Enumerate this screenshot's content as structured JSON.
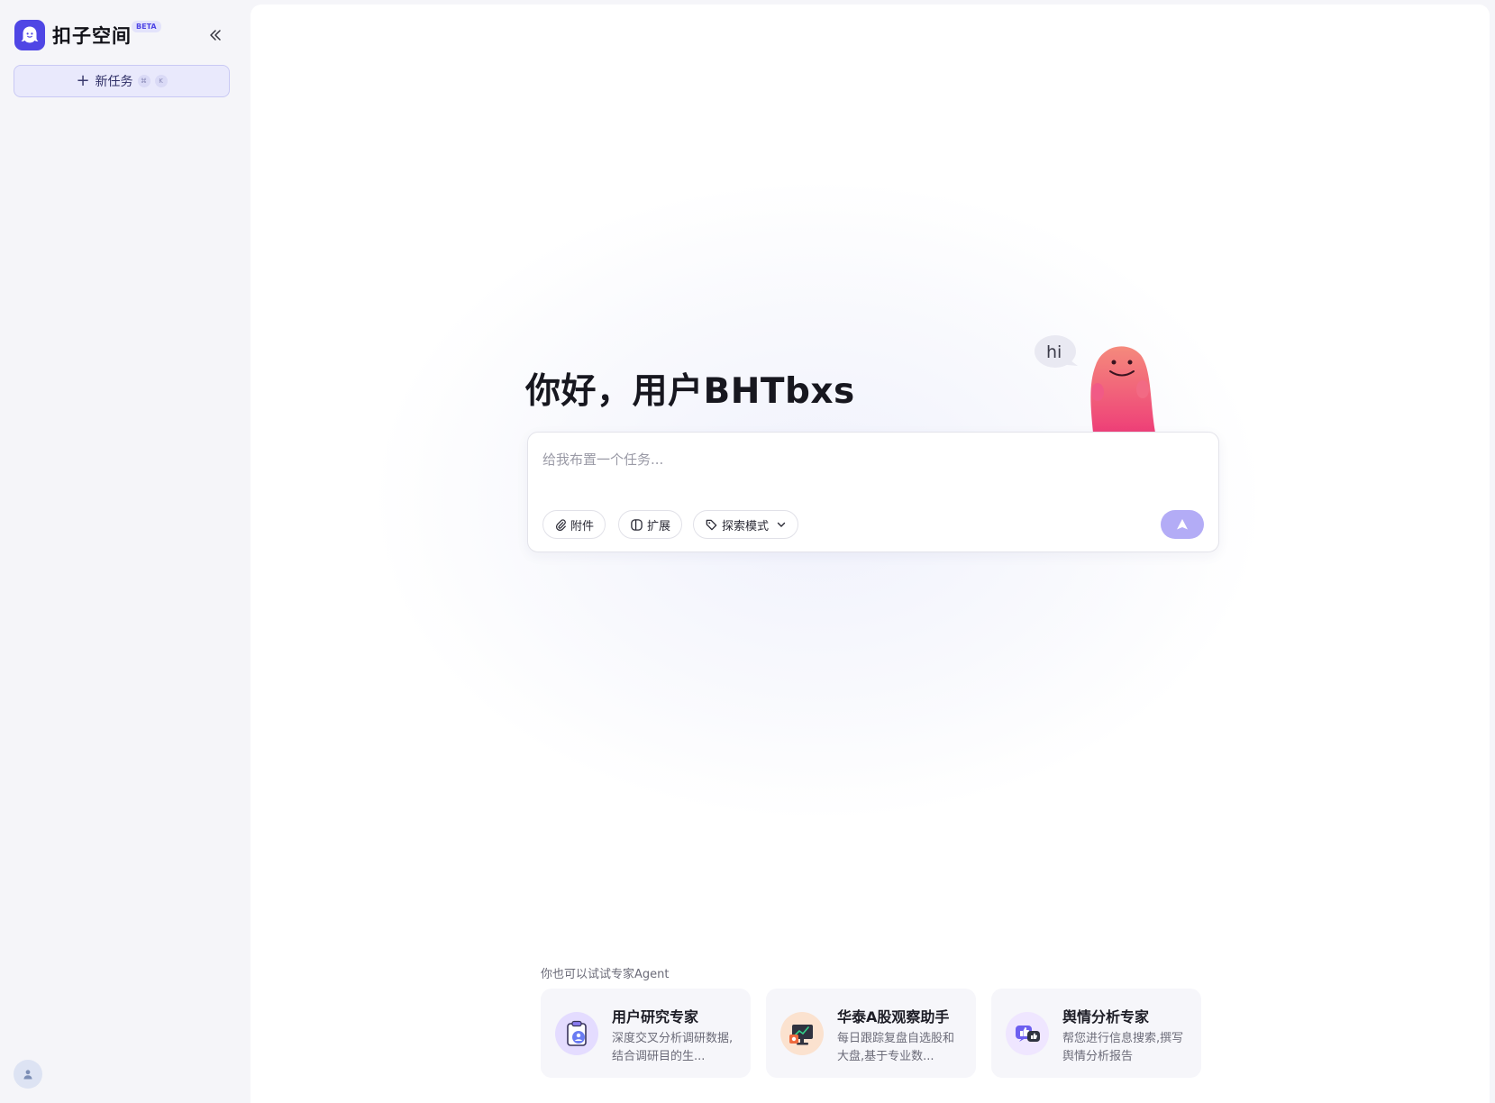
{
  "sidebar": {
    "app_name": "扣子空间",
    "beta_badge": "BETA",
    "collapse_icon": "double-chevron-left-icon",
    "new_task": {
      "label": "新任务",
      "shortcut_1": "⌘",
      "shortcut_2": "K"
    },
    "user_avatar_icon": "user-icon"
  },
  "main": {
    "greeting": "你好，用户BHTbxs",
    "mascot_bubble": "hi",
    "composer": {
      "placeholder": "给我布置一个任务...",
      "attach_label": "附件",
      "extend_label": "扩展",
      "mode_label": "探索模式",
      "send_icon": "send-arrow-icon"
    },
    "agents": {
      "title": "你也可以试试专家Agent",
      "items": [
        {
          "name": "用户研究专家",
          "desc": "深度交叉分析调研数据,结合调研目的生...",
          "icon": "clipboard-user-icon"
        },
        {
          "name": "华泰A股观察助手",
          "desc": "每日跟踪复盘自选股和大盘,基于专业数...",
          "icon": "stock-monitor-icon"
        },
        {
          "name": "舆情分析专家",
          "desc": "帮您进行信息搜索,撰写舆情分析报告",
          "icon": "thumbs-chat-icon"
        }
      ]
    }
  },
  "colors": {
    "accent": "#4f46e5",
    "send_button": "#b3acf6",
    "new_task_bg": "#e9e9fc",
    "mascot": "#f0607a"
  }
}
